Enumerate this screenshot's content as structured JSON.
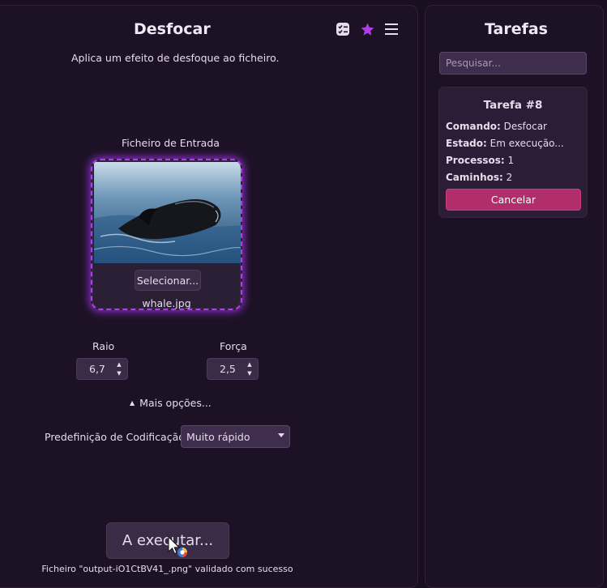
{
  "main": {
    "title": "Desfocar",
    "description": "Aplica um efeito de desfoque ao ficheiro.",
    "toolbar_icons": [
      "checklist-icon",
      "star-icon",
      "menu-icon"
    ],
    "input_file": {
      "label": "Ficheiro de Entrada",
      "select_label": "Selecionar...",
      "file_name": "whale.jpg"
    },
    "radius": {
      "label": "Raio",
      "value": "6,7"
    },
    "strength": {
      "label": "Força",
      "value": "2,5"
    },
    "more_options": "Mais opções...",
    "preset": {
      "label": "Predefinição de Codificação",
      "value": "Muito rápido"
    },
    "run_label": "A executar...",
    "status": "Ficheiro \"output-iO1CtBV41_.png\" validado com sucesso"
  },
  "tasks": {
    "title": "Tarefas",
    "search_placeholder": "Pesquisar...",
    "card": {
      "title": "Tarefa #8",
      "command_label": "Comando:",
      "command_value": "Desfocar",
      "state_label": "Estado:",
      "state_value": "Em execução...",
      "processes_label": "Processos:",
      "processes_value": "1",
      "paths_label": "Caminhos:",
      "paths_value": "2",
      "cancel_label": "Cancelar"
    }
  },
  "colors": {
    "background": "#1a0f21",
    "accent": "#b03ee8",
    "cancel": "#b22e6b"
  }
}
